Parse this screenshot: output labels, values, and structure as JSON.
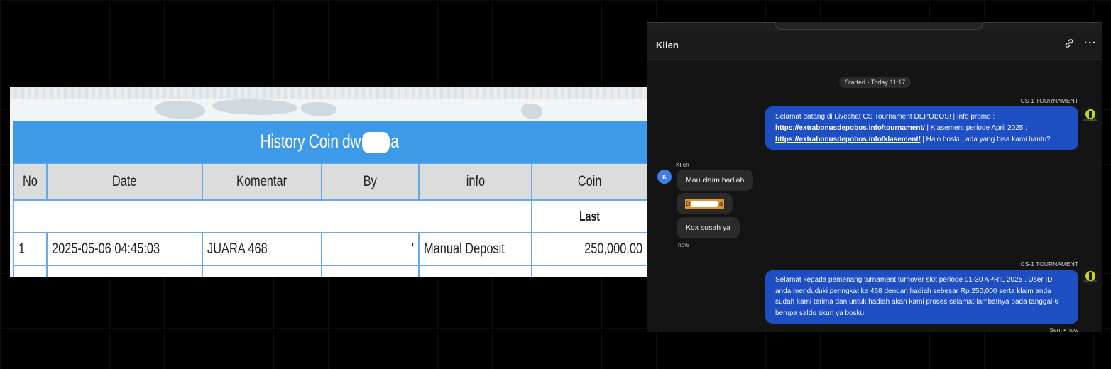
{
  "history": {
    "title_prefix": "History Coin dw",
    "title_suffix": "a",
    "columns": [
      "No",
      "Date",
      "Komentar",
      "By",
      "info",
      "Coin"
    ],
    "last_label": "Last",
    "rows": [
      {
        "no": "1",
        "date": "2025-05-06 04:45:03",
        "komentar": "JUARA 468",
        "by": "'",
        "info": "Manual Deposit",
        "coin": "250,000.00"
      }
    ]
  },
  "chat": {
    "title": "Klien",
    "more_label": "···",
    "started": "Started - Today 11:17",
    "agent_name": "CS-1 TOURNAMENT",
    "agent_logo_caption": "DEPOBOS",
    "welcome": {
      "part1": "Selamat datang di Livechat CS Tournament DEPOBOS! | Info promo :",
      "link1": "https://extrabonusdepobos.info/tournament/",
      "part2": " | Klasement periode April 2025 :",
      "link2": "https://extrabonusdepobos.info/klasement/",
      "part3": " | Halo bosku, ada yang bisa kami bantu?"
    },
    "client_label": "Klien",
    "client_initial": "K",
    "client_messages": [
      "Mau claim hadiah",
      "Kox susah ya"
    ],
    "redacted_prefix": "D",
    "redacted_suffix": "a",
    "client_time": "now",
    "reply": "Selamat kepada pemenang turnament turnover slot periode 01-30 APRIL 2025 . User ID anda menduduki peringkat ke 468 dengan hadiah sebesar Rp.250,000 serta klaim anda sudah kami terima dan untuk hadiah akan kami proses selamat-lambatnya pada tanggal-6 berupa saldo akun ya bosku",
    "sent_status": "Sent • now"
  }
}
